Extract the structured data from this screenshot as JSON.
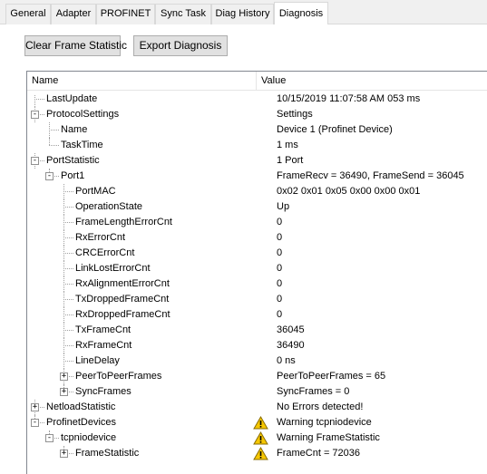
{
  "tabs": [
    "General",
    "Adapter",
    "PROFINET",
    "Sync Task",
    "Diag History",
    "Diagnosis"
  ],
  "active_tab": "Diagnosis",
  "buttons": {
    "clear": "Clear Frame Statistic",
    "export": "Export Diagnosis"
  },
  "columns": {
    "name": "Name",
    "value": "Value"
  },
  "rows": [
    {
      "name": "LastUpdate",
      "value": "10/15/2019 11:07:58 AM 053 ms",
      "level": 0,
      "exp": "",
      "warn": false
    },
    {
      "name": "ProtocolSettings",
      "value": "Settings",
      "level": 0,
      "exp": "-",
      "warn": false
    },
    {
      "name": "Name",
      "value": "Device 1 (Profinet Device)",
      "level": 1,
      "exp": "",
      "warn": false
    },
    {
      "name": "TaskTime",
      "value": "1 ms",
      "level": 1,
      "exp": "",
      "warn": false
    },
    {
      "name": "PortStatistic",
      "value": "1 Port",
      "level": 0,
      "exp": "-",
      "warn": false
    },
    {
      "name": "Port1",
      "value": "FrameRecv = 36490, FrameSend = 36045",
      "level": 1,
      "exp": "-",
      "warn": false
    },
    {
      "name": "PortMAC",
      "value": "0x02 0x01 0x05 0x00 0x00 0x01",
      "level": 2,
      "exp": "",
      "warn": false
    },
    {
      "name": "OperationState",
      "value": "Up",
      "level": 2,
      "exp": "",
      "warn": false
    },
    {
      "name": "FrameLengthErrorCnt",
      "value": "0",
      "level": 2,
      "exp": "",
      "warn": false
    },
    {
      "name": "RxErrorCnt",
      "value": "0",
      "level": 2,
      "exp": "",
      "warn": false
    },
    {
      "name": "CRCErrorCnt",
      "value": "0",
      "level": 2,
      "exp": "",
      "warn": false
    },
    {
      "name": "LinkLostErrorCnt",
      "value": "0",
      "level": 2,
      "exp": "",
      "warn": false
    },
    {
      "name": "RxAlignmentErrorCnt",
      "value": "0",
      "level": 2,
      "exp": "",
      "warn": false
    },
    {
      "name": "TxDroppedFrameCnt",
      "value": "0",
      "level": 2,
      "exp": "",
      "warn": false
    },
    {
      "name": "RxDroppedFrameCnt",
      "value": "0",
      "level": 2,
      "exp": "",
      "warn": false
    },
    {
      "name": "TxFrameCnt",
      "value": "36045",
      "level": 2,
      "exp": "",
      "warn": false
    },
    {
      "name": "RxFrameCnt",
      "value": "36490",
      "level": 2,
      "exp": "",
      "warn": false
    },
    {
      "name": "LineDelay",
      "value": "0 ns",
      "level": 2,
      "exp": "",
      "warn": false
    },
    {
      "name": "PeerToPeerFrames",
      "value": "PeerToPeerFrames = 65",
      "level": 2,
      "exp": "+",
      "warn": false
    },
    {
      "name": "SyncFrames",
      "value": "SyncFrames = 0",
      "level": 2,
      "exp": "+",
      "warn": false
    },
    {
      "name": "NetloadStatistic",
      "value": "No Errors detected!",
      "level": 0,
      "exp": "+",
      "warn": false
    },
    {
      "name": "ProfinetDevices",
      "value": "Warning tcpniodevice",
      "level": 0,
      "exp": "-",
      "warn": true
    },
    {
      "name": "tcpniodevice",
      "value": "Warning FrameStatistic",
      "level": 1,
      "exp": "-",
      "warn": true
    },
    {
      "name": "FrameStatistic",
      "value": "FrameCnt = 72036",
      "level": 2,
      "exp": "+",
      "warn": true
    }
  ]
}
